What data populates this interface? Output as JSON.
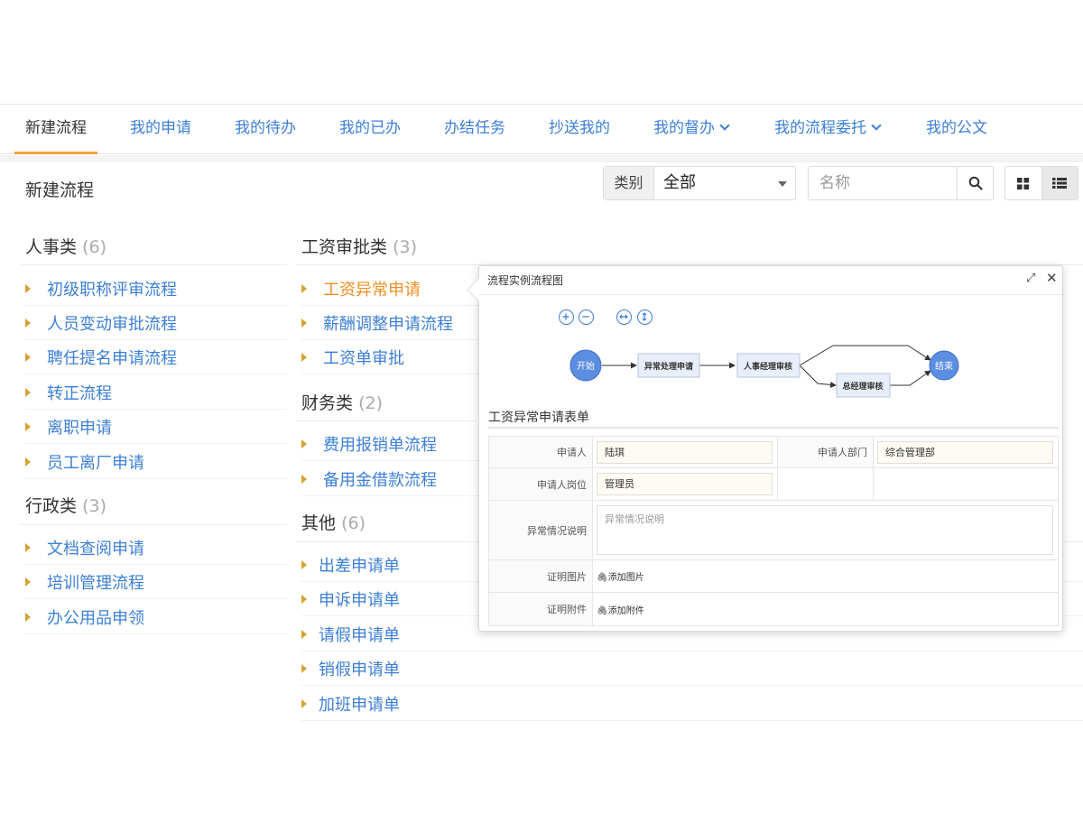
{
  "nav": {
    "tabs": [
      {
        "label": "新建流程"
      },
      {
        "label": "我的申请"
      },
      {
        "label": "我的待办"
      },
      {
        "label": "我的已办"
      },
      {
        "label": "办结任务"
      },
      {
        "label": "抄送我的"
      },
      {
        "label": "我的督办"
      },
      {
        "label": "我的流程委托"
      },
      {
        "label": "我的公文"
      }
    ]
  },
  "page": {
    "title": "新建流程"
  },
  "toolbar": {
    "category_label": "类别",
    "category_value": "全部",
    "search_placeholder": "名称"
  },
  "categories": {
    "hr": {
      "name": "人事类",
      "count": "(6)",
      "items": [
        "初级职称评审流程",
        "人员变动审批流程",
        "聘任提名申请流程",
        "转正流程",
        "离职申请",
        "员工离厂申请"
      ]
    },
    "admin": {
      "name": "行政类",
      "count": "(3)",
      "items": [
        "文档查阅申请",
        "培训管理流程",
        "办公用品申领"
      ]
    },
    "salary": {
      "name": "工资审批类",
      "count": "(3)",
      "items": [
        "工资异常申请",
        "薪酬调整申请流程",
        "工资单审批"
      ]
    },
    "finance": {
      "name": "财务类",
      "count": "(2)",
      "items": [
        "费用报销单流程",
        "备用金借款流程"
      ]
    },
    "other": {
      "name": "其他",
      "count": "(6)",
      "items": [
        "出差申请单",
        "申诉申请单",
        "请假申请单",
        "销假申请单",
        "加班申请单"
      ]
    }
  },
  "popup": {
    "title": "流程实例流程图",
    "flow": {
      "start": "开始",
      "node1": "异常处理申请",
      "node2": "人事经理审核",
      "node3": "总经理审核",
      "end": "结束"
    },
    "form_title": "工资异常申请表单",
    "fields": {
      "applicant_label": "申请人",
      "applicant_value": "陆琪",
      "dept_label": "申请人部门",
      "dept_value": "综合管理部",
      "position_label": "申请人岗位",
      "position_value": "管理员",
      "desc_label": "异常情况说明",
      "desc_placeholder": "异常情况说明",
      "photo_label": "证明图片",
      "photo_action": "添加图片",
      "attach_label": "证明附件",
      "attach_action": "添加附件"
    }
  },
  "colors": {
    "link": "#3d7fd6",
    "active_tab_underline": "#f0a23b",
    "highlight": "#ee8f25",
    "bullet": "#d6a233"
  }
}
